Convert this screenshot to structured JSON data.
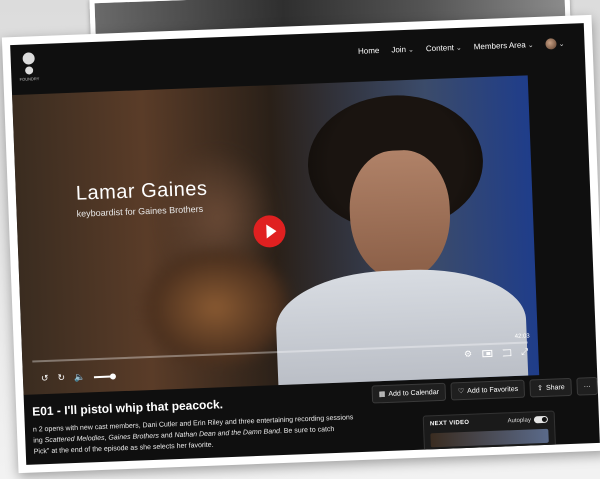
{
  "site": {
    "logo_text": "FOUNDRY"
  },
  "nav": {
    "home": "Home",
    "join": "Join",
    "content": "Content",
    "members_area": "Members Area"
  },
  "video": {
    "overlay_name": "Lamar Gaines",
    "overlay_role": "keyboardist for Gaines Brothers",
    "duration": "42:03"
  },
  "episode": {
    "title": "E01 - I'll pistol whip that peacock.",
    "description_line1": "n 2 opens with new cast members, Dani Cutler and Erin Riley and three entertaining recording sessions",
    "description_line2_prefix": "ing ",
    "description_em1": "Scattered Melodies",
    "description_sep1": ", ",
    "description_em2": "Gaines Brothers",
    "description_sep2": " and ",
    "description_em3": "Nathan Dean and the Damn Band",
    "description_line2_suffix": ".  Be sure to catch",
    "description_line3": "Pick\" at the end of the episode as she selects her favorite."
  },
  "actions": {
    "add_to_calendar": "Add to Calendar",
    "add_to_favorites": "Add to Favorites",
    "share": "Share",
    "more": "···"
  },
  "next_video": {
    "label": "NEXT VIDEO",
    "autoplay_label": "Autoplay"
  },
  "colors": {
    "play_button": "#e02020",
    "page_background": "#0f0f0f"
  },
  "icons": {
    "rewind": "rewind-icon",
    "forward": "forward-icon",
    "volume": "volume-icon",
    "settings": "gear-icon",
    "pip": "picture-in-picture-icon",
    "cast": "cast-icon",
    "fullscreen": "fullscreen-icon"
  }
}
